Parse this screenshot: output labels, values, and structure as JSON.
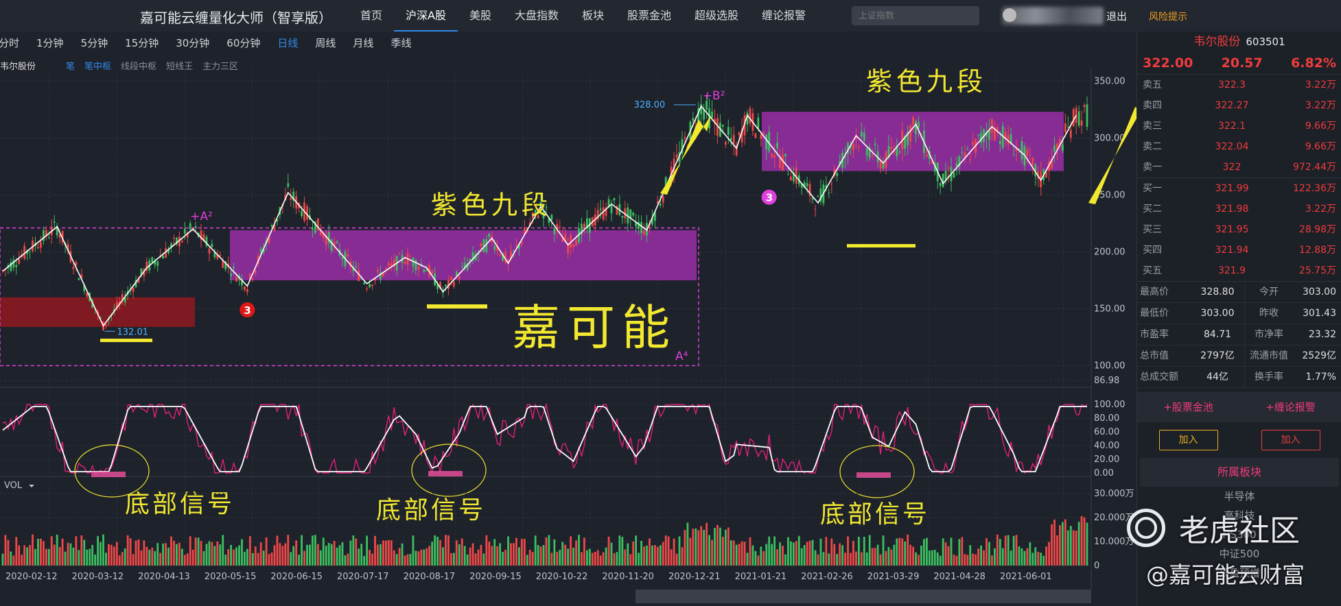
{
  "app": {
    "title": "嘉可能云缠量化大师（智享版）"
  },
  "nav": [
    "首页",
    "沪深A股",
    "美股",
    "大盘指数",
    "板块",
    "股票金池",
    "超级选股",
    "缠论报警"
  ],
  "nav_active": 1,
  "search": {
    "placeholder": "上证指数"
  },
  "header": {
    "logout": "退出",
    "risk": "风险提示"
  },
  "periods": [
    "分时",
    "1分钟",
    "5分钟",
    "15分钟",
    "30分钟",
    "60分钟",
    "日线",
    "周线",
    "月线",
    "季线"
  ],
  "period_active": 6,
  "indicator_row": {
    "name": "韦尔股份",
    "tabs": [
      "笔",
      "笔中枢",
      "线段中枢",
      "短线王",
      "主力三区"
    ],
    "active": [
      0,
      1
    ]
  },
  "chart_data": {
    "type": "candlestick",
    "price_axis": {
      "ticks": [
        "350.00",
        "300.00",
        "250.00",
        "200.00",
        "150.00",
        "100.00",
        "86.98"
      ],
      "values": [
        350,
        300,
        250,
        200,
        150,
        100,
        86.98
      ],
      "range": [
        86.98,
        355
      ]
    },
    "dates": [
      "2020-02-12",
      "2020-03-12",
      "2020-04-13",
      "2020-05-15",
      "2020-06-15",
      "2020-07-17",
      "2020-08-17",
      "2020-09-15",
      "2020-10-22",
      "2020-11-20",
      "2020-12-21",
      "2021-01-21",
      "2021-02-26",
      "2021-03-29",
      "2021-04-28",
      "2021-06-01"
    ],
    "zigzag": [
      [
        0,
        183
      ],
      [
        20,
        222
      ],
      [
        37,
        135
      ],
      [
        53,
        186
      ],
      [
        70,
        220
      ],
      [
        90,
        170
      ],
      [
        105,
        252
      ],
      [
        134,
        172
      ],
      [
        148,
        195
      ],
      [
        156,
        186
      ],
      [
        162,
        165
      ],
      [
        180,
        212
      ],
      [
        186,
        190
      ],
      [
        198,
        240
      ],
      [
        208,
        206
      ],
      [
        224,
        242
      ],
      [
        237,
        219
      ],
      [
        257,
        328
      ],
      [
        270,
        291
      ],
      [
        274,
        320
      ],
      [
        287,
        280
      ],
      [
        300,
        243
      ],
      [
        314,
        302
      ],
      [
        324,
        278
      ],
      [
        336,
        312
      ],
      [
        346,
        260
      ],
      [
        364,
        310
      ],
      [
        376,
        285
      ],
      [
        382,
        263
      ],
      [
        395,
        320
      ]
    ],
    "price_labels": {
      "low": "132.01",
      "high": "328.00"
    },
    "markers": {
      "a2": "+A²",
      "b2": "+B²",
      "a4": "A⁴",
      "sig3": "3"
    },
    "annotations": {
      "purple_zone_1": "紫色九段",
      "purple_zone_2": "紫色九段",
      "brand_text": "嘉可能",
      "bottom_signal": "底部信号"
    },
    "osc_axis": {
      "ticks": [
        "100.00",
        "80.00",
        "60.00",
        "40.00",
        "20.00",
        "0.00"
      ],
      "values": [
        100,
        80,
        60,
        40,
        20,
        0
      ]
    },
    "vol_axis": {
      "label": "VOL",
      "ticks": [
        "30.000万",
        "20.000万",
        "10.000万",
        "0"
      ],
      "values": [
        30,
        20,
        10,
        0
      ]
    },
    "colors": {
      "up": "#f04848",
      "down": "#3cc060",
      "zigzag": "#ffffff",
      "purple_box": "#9a2ea8",
      "red_box": "#8a1a22",
      "annotation": "#f2e830",
      "magenta": "#e040e0",
      "axis_text": "#c0c4cc"
    }
  },
  "stock": {
    "name": "韦尔股份",
    "code": "603501",
    "price": "322.00",
    "change": "20.57",
    "pct": "6.82%"
  },
  "orderbook": {
    "asks": [
      {
        "label": "卖五",
        "price": "322.3",
        "vol": "3.22万"
      },
      {
        "label": "卖四",
        "price": "322.27",
        "vol": "3.22万"
      },
      {
        "label": "卖三",
        "price": "322.1",
        "vol": "9.66万"
      },
      {
        "label": "卖二",
        "price": "322.04",
        "vol": "9.66万"
      },
      {
        "label": "卖一",
        "price": "322",
        "vol": "972.44万"
      }
    ],
    "bids": [
      {
        "label": "买一",
        "price": "321.99",
        "vol": "122.36万"
      },
      {
        "label": "买二",
        "price": "321.98",
        "vol": "3.22万"
      },
      {
        "label": "买三",
        "price": "321.95",
        "vol": "28.98万"
      },
      {
        "label": "买四",
        "price": "321.94",
        "vol": "12.88万"
      },
      {
        "label": "买五",
        "price": "321.9",
        "vol": "25.75万"
      }
    ]
  },
  "stats": [
    {
      "k": "最高价",
      "v": "328.80",
      "k2": "今开",
      "v2": "303.00"
    },
    {
      "k": "最低价",
      "v": "303.00",
      "k2": "昨收",
      "v2": "301.43"
    },
    {
      "k": "市盈率",
      "v": "84.71",
      "k2": "市净率",
      "v2": "23.32"
    },
    {
      "k": "总市值",
      "v": "2797亿",
      "k2": "流通市值",
      "v2": "2529亿"
    },
    {
      "k": "总成交额",
      "v": "44亿",
      "k2": "换手率",
      "v2": "1.77%"
    }
  ],
  "actions": {
    "pool": "+股票金池",
    "alert": "+缠论报警",
    "add1": "加入",
    "add2": "加入"
  },
  "sector": {
    "title": "所属板块",
    "items": [
      "半导体",
      "高科技",
      "HS300",
      "中证500",
      "预盈预增"
    ]
  },
  "watermark": {
    "brand": "老虎社区",
    "handle": "@嘉可能云财富"
  }
}
